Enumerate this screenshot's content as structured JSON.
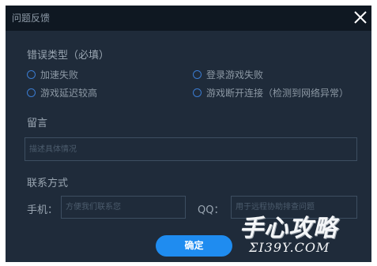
{
  "dialog": {
    "title": "问题反馈",
    "close_symbol": "✕"
  },
  "error_type": {
    "label": "错误类型（必填）",
    "options": [
      {
        "label": "加速失败"
      },
      {
        "label": "登录游戏失败"
      },
      {
        "label": "游戏延迟较高"
      },
      {
        "label": "游戏断开连接（检测到网络异常）"
      }
    ]
  },
  "message": {
    "label": "留言",
    "placeholder": "描述具体情况"
  },
  "contact": {
    "label": "联系方式",
    "phone_label": "手机：",
    "phone_placeholder": "方便我们联系您",
    "qq_label": "QQ：",
    "qq_placeholder": "用于远程协助排查问题"
  },
  "confirm_label": "确定",
  "watermark": {
    "text": "手心攻略",
    "url": "ΣI39Y.COM"
  },
  "colors": {
    "dialog_bg": "#1f2b3a",
    "titlebar_bg": "#0f1822",
    "accent": "#1f8cf0",
    "radio_border": "#3a7bd0"
  }
}
